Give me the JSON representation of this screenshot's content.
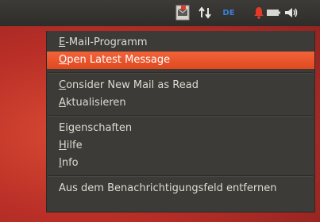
{
  "panel": {
    "icons": [
      "mail-notification-icon",
      "network-arrows-icon",
      "keyboard-layout-indicator",
      "notification-bell-icon",
      "battery-icon",
      "volume-icon"
    ],
    "keyboard_label": "DE"
  },
  "menu": {
    "groups": [
      [
        {
          "label_mn": "E",
          "label_rest": "-Mail-Programm"
        },
        {
          "label_mn": "O",
          "label_rest": "pen Latest Message",
          "highlighted": true
        }
      ],
      [
        {
          "label_mn": "C",
          "label_rest": "onsider New Mail as Read"
        },
        {
          "label_mn": "A",
          "label_rest": "ktualisieren"
        }
      ],
      [
        {
          "label_pre": "Ei",
          "label_mn": "g",
          "label_rest": "enschaften"
        },
        {
          "label_mn": "H",
          "label_rest": "ilfe"
        },
        {
          "label_mn": "I",
          "label_rest": "nfo"
        }
      ],
      [
        {
          "label_pre": "",
          "label_mn": "",
          "label_rest": "Aus dem Benachrichtigungsfeld entfernen"
        }
      ]
    ]
  },
  "colors": {
    "accent": "#e95420",
    "panel": "#3c3b37",
    "text": "#dfdbd2"
  }
}
